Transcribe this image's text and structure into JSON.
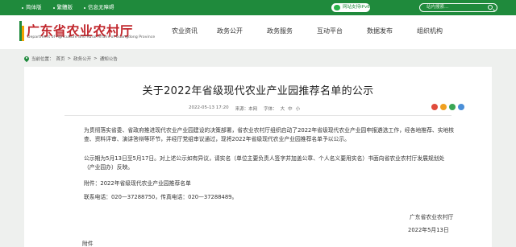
{
  "topbar": {
    "links": [
      "简体版",
      "繁體版",
      "信息无障碍"
    ],
    "wechat": "网站支持IPv6",
    "lang": "",
    "search_placeholder": "站内搜索…"
  },
  "header": {
    "title": "广东省农业农村厅",
    "subtitle": "Department of Agriculture and Rural Affairs of Guangdong Province",
    "nav": [
      "农业资讯",
      "政务公开",
      "政务服务",
      "互动平台",
      "数据发布",
      "组织机构"
    ]
  },
  "breadcrumb": {
    "prefix": "当前位置：",
    "items": [
      "首页",
      "政务公开",
      "通知公告"
    ],
    "separator": ">"
  },
  "article": {
    "title": "关于2022年省级现代农业产业园推荐名单的公示",
    "date": "2022-05-13 17:20",
    "source_label": "来源：",
    "source": "本网",
    "fontsize_label": "字体：",
    "sizes": [
      "大",
      "中",
      "小"
    ],
    "paragraphs": [
      "为贯彻落实省委、省政府推进现代农业产业园建设的决策部署，省农业农村厅组织启动了2022年省级现代农业产业园申报遴选工作，经各地推荐、实地核查、资料评审、演讲答辩等环节，并经厅党组审议通过，现将2022年省级现代农业产业园推荐名单予以公示。",
      "公示期为5月13日至5月17日。对上述公示如有异议，请实名（单位主要负责人签字并加盖公章、个人名义要用实名）书面向省农业农村厅发展规划处（产业园办）反映。",
      "附件：2022年省级现代农业产业园推荐名单",
      "联系电话：020—37288750，传真电话：020—37288489。"
    ],
    "signature": "广东省农业农村厅",
    "sign_date": "2022年5月13日",
    "attachment_label": "附件"
  },
  "colors": {
    "brand_green": "#1f8a3c",
    "title_red": "#c1272d",
    "share": [
      "#e04b3c",
      "#f0a020",
      "#3aa655",
      "#4a8fd8"
    ]
  }
}
